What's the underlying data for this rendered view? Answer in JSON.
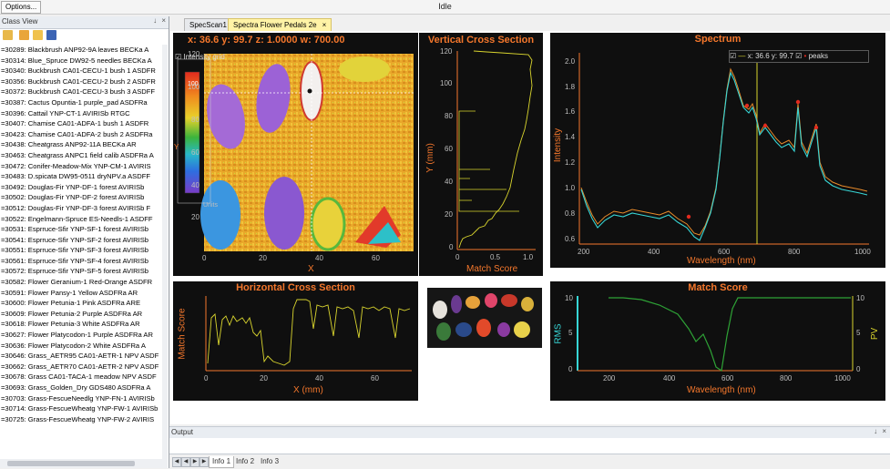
{
  "app": {
    "options_label": "Options...",
    "title": "Idle"
  },
  "class_view": {
    "title": "Class View",
    "pin": "↓",
    "close": "×",
    "items": [
      "=30289: Blackbrush ANP92-9A leaves   BECKa A",
      "=30314: Blue_Spruce DW92-5 needles   BECKa A",
      "=30340: Buckbrush CA01-CECU-1 bush 1 ASDFR",
      "=30356: Buckbrush CA01-CECU-2 bush 2 ASDFR",
      "=30372: Buckbrush CA01-CECU-3 bush 3 ASDFF",
      "=30387: Cactus Opuntia-1 purple_pad ASDFRa",
      "=30396: Cattail YNP-CT-1         AVIRISb RTGC",
      "=30407: Chamise CA01-ADFA-1 bush 1  ASDFR",
      "=30423: Chamise CA01-ADFA-2 bush 2  ASDFRa",
      "=30438: Cheatgrass ANP92-11A        BECKa AR",
      "=30463: Cheatgrass ANPC1 field calib ASDFRa A",
      "=30472: Conifer-Meadow-Mix YNP-CM-1 AVIRIS",
      "=30483: D.spicata DW95-0511 dryNPV.a ASDFF",
      "=30492: Douglas-Fir YNP-DF-1 forest AVIRISb",
      "=30502: Douglas-Fir YNP-DF-2 forest AVIRISb",
      "=30512: Douglas-Fir YNP-DF-3 forest AVIRISb F",
      "=30522: Engelmann-Spruce ES-Needls-1 ASDFF",
      "=30531: Esprruce-Sfir YNP-SF-1 forest AVIRISb",
      "=30541: Esprruce-Sfir YNP-SF-2 forest AVIRISb",
      "=30551: Esprruce-Sfir YNP-SF-3 forest AVIRISb",
      "=30561: Esprruce-Sfir YNP-SF-4 forest AVIRISb",
      "=30572: Esprruce-Sfir YNP-SF-5 forest AVIRISb",
      "=30582: Flower Geranium-1 Red-Orange ASDFR",
      "=30591: Flower Pansy-1 Yellow        ASDFRa AR",
      "=30600: Flower Petunia-1 Pink        ASDFRa ARE",
      "=30609: Flower Petunia-2 Purple      ASDFRa AR",
      "=30618: Flower Petunia-3 White       ASDFRa AR",
      "=30627: Flower Platycodon-1 Purple   ASDFRa AR",
      "=30636: Flower Platycodon-2 White    ASDFRa A",
      "=30646: Grass_AETR95 CA01-AETR-1 NPV ASDF",
      "=30662: Grass_AETR70 CA01-AETR-2 NPV ASDF",
      "=30678: Grass CA01-TACA-1 meadow NPV ASDF",
      "=30693: Grass_Golden_Dry GDS480      ASDFRa A",
      "=30703: Grass-FescueNeedlg YNP-FN-1 AVIRISb",
      "=30714: Grass-FescueWheatg YNP-FW-1 AVIRISb",
      "=30725: Grass-FescueWheatg YNP-FW-2 AVIRIS"
    ]
  },
  "tabs": [
    {
      "label": "SpecScan1"
    },
    {
      "label": "Spectra Flower Pedals 2e",
      "close": "×"
    }
  ],
  "image_view": {
    "readout": "x: 36.6  y: 99.7  z:   1.0000  w:   700.00",
    "checkbox_label": "Intensity grid",
    "colorbar_top": "100",
    "colorbar_label": "Units",
    "colorbar_axis": "Y",
    "xlabel": "X",
    "xticks": [
      "0",
      "20",
      "40",
      "60"
    ],
    "yticks": [
      "120",
      "100",
      "80",
      "60",
      "40",
      "20"
    ]
  },
  "vertical_cross_section": {
    "title": "Vertical Cross Section",
    "xlabel": "Match Score",
    "ylabel": "Y (mm)",
    "yticks": [
      "120",
      "100",
      "80",
      "60",
      "40",
      "20",
      "0"
    ],
    "xticks": [
      "0",
      "0.5",
      "1.0"
    ]
  },
  "horizontal_cross_section": {
    "title": "Horizontal Cross Section",
    "xlabel": "X (mm)",
    "ylabel": "Match Score",
    "xticks": [
      "0",
      "20",
      "40",
      "60"
    ]
  },
  "spectrum": {
    "title": "Spectrum",
    "legend_cursor": "x: 36.6  y: 99.7",
    "legend_peaks": "peaks",
    "xlabel": "Wavelength (nm)",
    "ylabel": "Intensity",
    "xticks": [
      "200",
      "400",
      "600",
      "800",
      "1000"
    ],
    "yticks": [
      "2.0",
      "1.8",
      "1.6",
      "1.4",
      "1.2",
      "1.0",
      "0.8",
      "0.6"
    ]
  },
  "match_score": {
    "title": "Match Score",
    "xlabel": "Wavelength (nm)",
    "ylabel_left": "RMS",
    "ylabel_right": "PV",
    "xticks": [
      "200",
      "400",
      "600",
      "800",
      "1000"
    ],
    "yticks_left": [
      "10",
      "5",
      "0"
    ],
    "yticks_right": [
      "10",
      "5",
      "0"
    ]
  },
  "output": {
    "title": "Output",
    "pin": "↓",
    "close": "×"
  },
  "bottom_tabs": [
    "Info 1",
    "Info 2",
    "Info 3"
  ],
  "colors": {
    "accent": "#f4772c",
    "cyan": "#37d6d6",
    "yellow": "#e4e23a",
    "green": "#2ea236",
    "tab_active": "#fff3a6"
  }
}
